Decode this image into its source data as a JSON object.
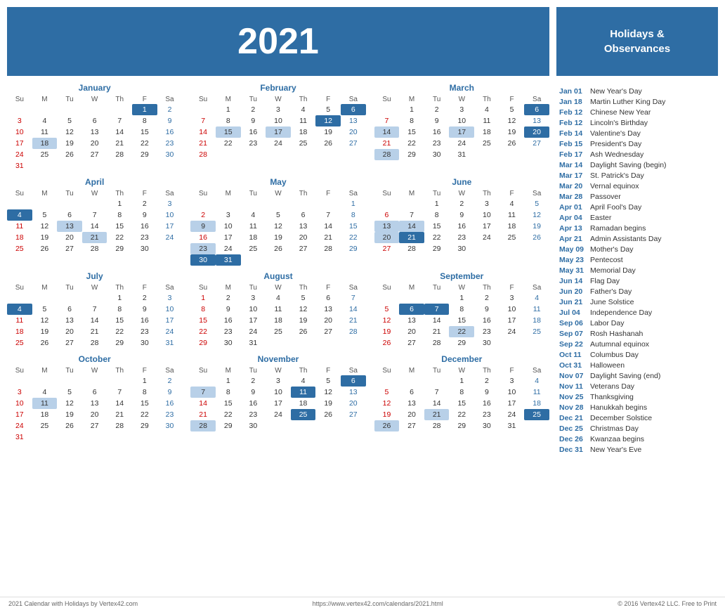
{
  "header": {
    "year": "2021"
  },
  "sidebar": {
    "title": "Holidays &\nObservances",
    "holidays": [
      {
        "date": "Jan 01",
        "name": "New Year's Day"
      },
      {
        "date": "Jan 18",
        "name": "Martin Luther King Day"
      },
      {
        "date": "Feb 12",
        "name": "Chinese New Year"
      },
      {
        "date": "Feb 12",
        "name": "Lincoln's Birthday"
      },
      {
        "date": "Feb 14",
        "name": "Valentine's Day"
      },
      {
        "date": "Feb 15",
        "name": "President's Day"
      },
      {
        "date": "Feb 17",
        "name": "Ash Wednesday"
      },
      {
        "date": "Mar 14",
        "name": "Daylight Saving (begin)"
      },
      {
        "date": "Mar 17",
        "name": "St. Patrick's Day"
      },
      {
        "date": "Mar 20",
        "name": "Vernal equinox"
      },
      {
        "date": "Mar 28",
        "name": "Passover"
      },
      {
        "date": "Apr 01",
        "name": "April Fool's Day"
      },
      {
        "date": "Apr 04",
        "name": "Easter"
      },
      {
        "date": "Apr 13",
        "name": "Ramadan begins"
      },
      {
        "date": "Apr 21",
        "name": "Admin Assistants Day"
      },
      {
        "date": "May 09",
        "name": "Mother's Day"
      },
      {
        "date": "May 23",
        "name": "Pentecost"
      },
      {
        "date": "May 31",
        "name": "Memorial Day"
      },
      {
        "date": "Jun 14",
        "name": "Flag Day"
      },
      {
        "date": "Jun 20",
        "name": "Father's Day"
      },
      {
        "date": "Jun 21",
        "name": "June Solstice"
      },
      {
        "date": "Jul 04",
        "name": "Independence Day"
      },
      {
        "date": "Sep 06",
        "name": "Labor Day"
      },
      {
        "date": "Sep 07",
        "name": "Rosh Hashanah"
      },
      {
        "date": "Sep 22",
        "name": "Autumnal equinox"
      },
      {
        "date": "Oct 11",
        "name": "Columbus Day"
      },
      {
        "date": "Oct 31",
        "name": "Halloween"
      },
      {
        "date": "Nov 07",
        "name": "Daylight Saving (end)"
      },
      {
        "date": "Nov 11",
        "name": "Veterans Day"
      },
      {
        "date": "Nov 25",
        "name": "Thanksgiving"
      },
      {
        "date": "Nov 28",
        "name": "Hanukkah begins"
      },
      {
        "date": "Dec 21",
        "name": "December Solstice"
      },
      {
        "date": "Dec 25",
        "name": "Christmas Day"
      },
      {
        "date": "Dec 26",
        "name": "Kwanzaa begins"
      },
      {
        "date": "Dec 31",
        "name": "New Year's Eve"
      }
    ]
  },
  "footer": {
    "left": "2021 Calendar with Holidays by Vertex42.com",
    "center": "https://www.vertex42.com/calendars/2021.html",
    "right": "© 2016 Vertex42 LLC. Free to Print"
  }
}
